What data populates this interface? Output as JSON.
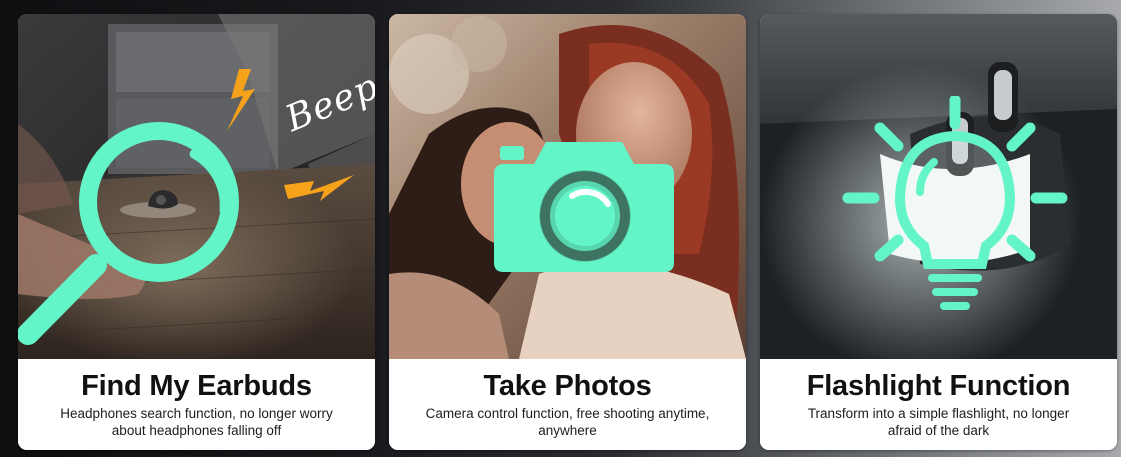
{
  "colors": {
    "accent": "#63f5c8",
    "bolt": "#f6a21a",
    "caption_bg": "#ffffff",
    "title_text": "#111111"
  },
  "cards": [
    {
      "title": "Find My Earbuds",
      "description": "Headphones search function, no longer worry about headphones falling off",
      "overlay_text": "Beep~",
      "icon": "magnifier-icon"
    },
    {
      "title": "Take Photos",
      "description": "Camera control function, free shooting anytime, anywhere",
      "icon": "camera-icon"
    },
    {
      "title": "Flashlight Function",
      "description": "Transform into a simple flashlight, no longer afraid of the dark",
      "icon": "lightbulb-icon"
    }
  ]
}
